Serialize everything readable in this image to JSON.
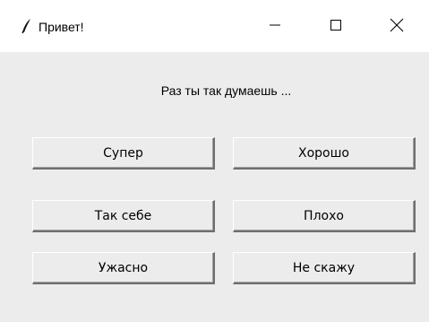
{
  "window": {
    "title": "Привет!",
    "icon": "feather-icon",
    "controls": {
      "minimize_icon": "minimize-icon",
      "maximize_icon": "maximize-icon",
      "close_icon": "close-icon"
    }
  },
  "message": "Раз ты так думаешь ...",
  "buttons": [
    {
      "label": "Супер"
    },
    {
      "label": "Хорошо"
    },
    {
      "label": "Так себе"
    },
    {
      "label": "Плохо"
    },
    {
      "label": "Ужасно"
    },
    {
      "label": "Не скажу"
    }
  ],
  "colors": {
    "titlebar_bg": "#ffffff",
    "content_bg": "#ececec",
    "button_bg": "#ececec",
    "button_shadow": "#6f6f6f"
  }
}
